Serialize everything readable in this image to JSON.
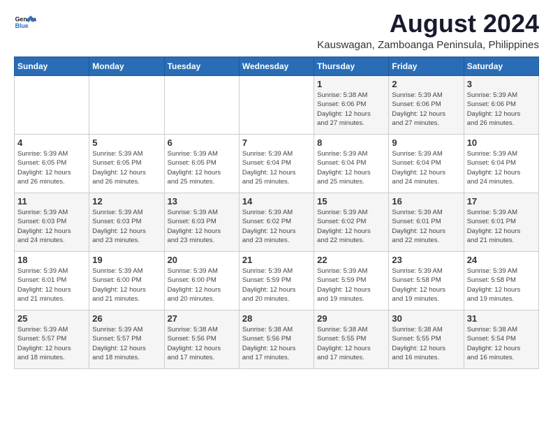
{
  "logo": {
    "general": "General",
    "blue": "Blue"
  },
  "title": {
    "month_year": "August 2024",
    "location": "Kauswagan, Zamboanga Peninsula, Philippines"
  },
  "weekdays": [
    "Sunday",
    "Monday",
    "Tuesday",
    "Wednesday",
    "Thursday",
    "Friday",
    "Saturday"
  ],
  "weeks": [
    [
      {
        "day": "",
        "info": ""
      },
      {
        "day": "",
        "info": ""
      },
      {
        "day": "",
        "info": ""
      },
      {
        "day": "",
        "info": ""
      },
      {
        "day": "1",
        "info": "Sunrise: 5:38 AM\nSunset: 6:06 PM\nDaylight: 12 hours\nand 27 minutes."
      },
      {
        "day": "2",
        "info": "Sunrise: 5:39 AM\nSunset: 6:06 PM\nDaylight: 12 hours\nand 27 minutes."
      },
      {
        "day": "3",
        "info": "Sunrise: 5:39 AM\nSunset: 6:06 PM\nDaylight: 12 hours\nand 26 minutes."
      }
    ],
    [
      {
        "day": "4",
        "info": "Sunrise: 5:39 AM\nSunset: 6:05 PM\nDaylight: 12 hours\nand 26 minutes."
      },
      {
        "day": "5",
        "info": "Sunrise: 5:39 AM\nSunset: 6:05 PM\nDaylight: 12 hours\nand 26 minutes."
      },
      {
        "day": "6",
        "info": "Sunrise: 5:39 AM\nSunset: 6:05 PM\nDaylight: 12 hours\nand 25 minutes."
      },
      {
        "day": "7",
        "info": "Sunrise: 5:39 AM\nSunset: 6:04 PM\nDaylight: 12 hours\nand 25 minutes."
      },
      {
        "day": "8",
        "info": "Sunrise: 5:39 AM\nSunset: 6:04 PM\nDaylight: 12 hours\nand 25 minutes."
      },
      {
        "day": "9",
        "info": "Sunrise: 5:39 AM\nSunset: 6:04 PM\nDaylight: 12 hours\nand 24 minutes."
      },
      {
        "day": "10",
        "info": "Sunrise: 5:39 AM\nSunset: 6:04 PM\nDaylight: 12 hours\nand 24 minutes."
      }
    ],
    [
      {
        "day": "11",
        "info": "Sunrise: 5:39 AM\nSunset: 6:03 PM\nDaylight: 12 hours\nand 24 minutes."
      },
      {
        "day": "12",
        "info": "Sunrise: 5:39 AM\nSunset: 6:03 PM\nDaylight: 12 hours\nand 23 minutes."
      },
      {
        "day": "13",
        "info": "Sunrise: 5:39 AM\nSunset: 6:03 PM\nDaylight: 12 hours\nand 23 minutes."
      },
      {
        "day": "14",
        "info": "Sunrise: 5:39 AM\nSunset: 6:02 PM\nDaylight: 12 hours\nand 23 minutes."
      },
      {
        "day": "15",
        "info": "Sunrise: 5:39 AM\nSunset: 6:02 PM\nDaylight: 12 hours\nand 22 minutes."
      },
      {
        "day": "16",
        "info": "Sunrise: 5:39 AM\nSunset: 6:01 PM\nDaylight: 12 hours\nand 22 minutes."
      },
      {
        "day": "17",
        "info": "Sunrise: 5:39 AM\nSunset: 6:01 PM\nDaylight: 12 hours\nand 21 minutes."
      }
    ],
    [
      {
        "day": "18",
        "info": "Sunrise: 5:39 AM\nSunset: 6:01 PM\nDaylight: 12 hours\nand 21 minutes."
      },
      {
        "day": "19",
        "info": "Sunrise: 5:39 AM\nSunset: 6:00 PM\nDaylight: 12 hours\nand 21 minutes."
      },
      {
        "day": "20",
        "info": "Sunrise: 5:39 AM\nSunset: 6:00 PM\nDaylight: 12 hours\nand 20 minutes."
      },
      {
        "day": "21",
        "info": "Sunrise: 5:39 AM\nSunset: 5:59 PM\nDaylight: 12 hours\nand 20 minutes."
      },
      {
        "day": "22",
        "info": "Sunrise: 5:39 AM\nSunset: 5:59 PM\nDaylight: 12 hours\nand 19 minutes."
      },
      {
        "day": "23",
        "info": "Sunrise: 5:39 AM\nSunset: 5:58 PM\nDaylight: 12 hours\nand 19 minutes."
      },
      {
        "day": "24",
        "info": "Sunrise: 5:39 AM\nSunset: 5:58 PM\nDaylight: 12 hours\nand 19 minutes."
      }
    ],
    [
      {
        "day": "25",
        "info": "Sunrise: 5:39 AM\nSunset: 5:57 PM\nDaylight: 12 hours\nand 18 minutes."
      },
      {
        "day": "26",
        "info": "Sunrise: 5:39 AM\nSunset: 5:57 PM\nDaylight: 12 hours\nand 18 minutes."
      },
      {
        "day": "27",
        "info": "Sunrise: 5:38 AM\nSunset: 5:56 PM\nDaylight: 12 hours\nand 17 minutes."
      },
      {
        "day": "28",
        "info": "Sunrise: 5:38 AM\nSunset: 5:56 PM\nDaylight: 12 hours\nand 17 minutes."
      },
      {
        "day": "29",
        "info": "Sunrise: 5:38 AM\nSunset: 5:55 PM\nDaylight: 12 hours\nand 17 minutes."
      },
      {
        "day": "30",
        "info": "Sunrise: 5:38 AM\nSunset: 5:55 PM\nDaylight: 12 hours\nand 16 minutes."
      },
      {
        "day": "31",
        "info": "Sunrise: 5:38 AM\nSunset: 5:54 PM\nDaylight: 12 hours\nand 16 minutes."
      }
    ]
  ]
}
